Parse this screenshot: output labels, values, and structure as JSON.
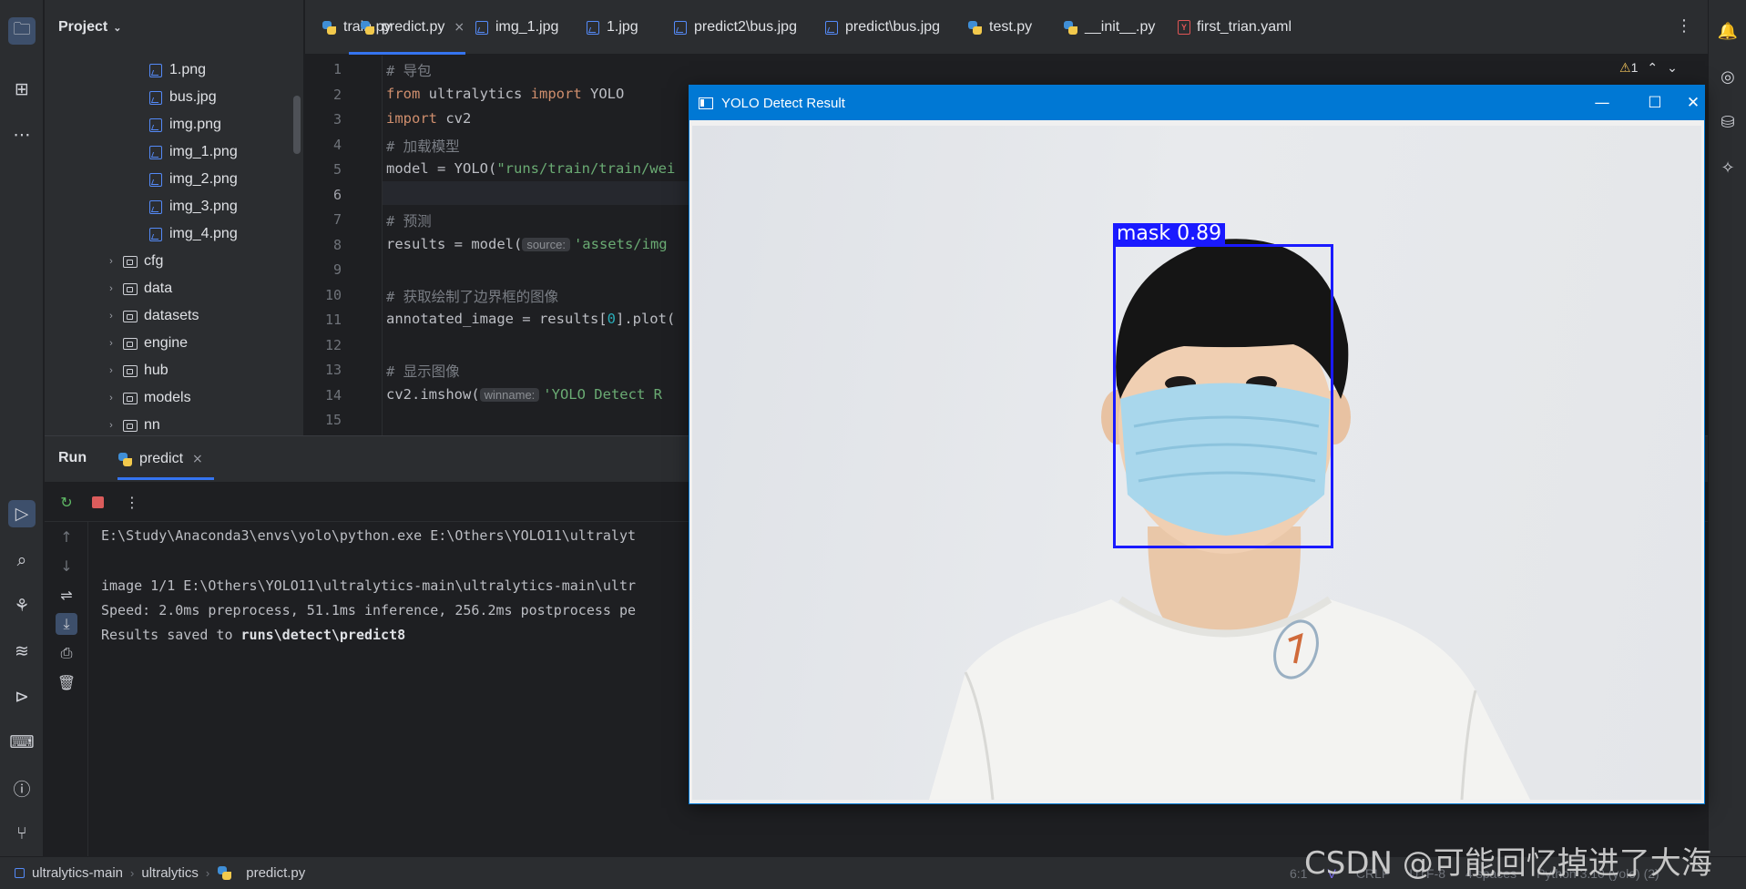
{
  "project_panel": {
    "title": "Project",
    "tree": [
      {
        "name": "1.png",
        "type": "image"
      },
      {
        "name": "bus.jpg",
        "type": "image"
      },
      {
        "name": "img.png",
        "type": "image"
      },
      {
        "name": "img_1.png",
        "type": "image"
      },
      {
        "name": "img_2.png",
        "type": "image"
      },
      {
        "name": "img_3.png",
        "type": "image"
      },
      {
        "name": "img_4.png",
        "type": "image"
      },
      {
        "name": "cfg",
        "type": "folder"
      },
      {
        "name": "data",
        "type": "folder"
      },
      {
        "name": "datasets",
        "type": "folder"
      },
      {
        "name": "engine",
        "type": "folder"
      },
      {
        "name": "hub",
        "type": "folder"
      },
      {
        "name": "models",
        "type": "folder"
      },
      {
        "name": "nn",
        "type": "folder"
      }
    ]
  },
  "tabs": [
    {
      "label": "train.py",
      "icon": "python-icon"
    },
    {
      "label": "predict.py",
      "icon": "python-icon",
      "active": true
    },
    {
      "label": "img_1.jpg",
      "icon": "image-icon"
    },
    {
      "label": "1.jpg",
      "icon": "image-icon"
    },
    {
      "label": "predict2\\bus.jpg",
      "icon": "image-icon"
    },
    {
      "label": "predict\\bus.jpg",
      "icon": "image-icon"
    },
    {
      "label": "test.py",
      "icon": "python-icon"
    },
    {
      "label": "__init__.py",
      "icon": "python-icon"
    },
    {
      "label": "first_trian.yaml",
      "icon": "yaml-icon"
    }
  ],
  "editor": {
    "line_numbers": [
      "1",
      "2",
      "3",
      "4",
      "5",
      "6",
      "7",
      "8",
      "9",
      "10",
      "11",
      "12",
      "13",
      "14",
      "15"
    ],
    "current_line": "6",
    "warnings_count": "1",
    "lines": {
      "l1": "# 导包",
      "l2_kw1": "from",
      "l2_mod": " ultralytics ",
      "l2_kw2": "import",
      "l2_name": " YOLO",
      "l3_kw": "import",
      "l3_name": " cv2",
      "l4": "# 加载模型",
      "l5_code": "model = YOLO(",
      "l5_str": "\"runs/train/train/wei",
      "l7": "# 预测",
      "l8_code": "results = model(",
      "l8_hint": "source:",
      "l8_str": "'assets/img",
      "l10": "# 获取绘制了边界框的图像",
      "l11_code": "annotated_image = results[",
      "l11_num": "0",
      "l11_tail": "].plot(",
      "l13": "# 显示图像",
      "l14_code": "cv2.imshow(",
      "l14_hint": "winname:",
      "l14_str": "'YOLO Detect R"
    }
  },
  "run_panel": {
    "title": "Run",
    "tab_label": "predict",
    "output": {
      "line1": "E:\\Study\\Anaconda3\\envs\\yolo\\python.exe E:\\Others\\YOLO11\\ultralyt",
      "line2": "image 1/1 E:\\Others\\YOLO11\\ultralytics-main\\ultralytics-main\\ultr",
      "line3": "Speed: 2.0ms preprocess, 51.1ms inference, 256.2ms postprocess pe",
      "line4_prefix": "Results saved to ",
      "line4_path": "runs\\detect\\predict8"
    }
  },
  "detect_window": {
    "title": "YOLO Detect Result",
    "detection_label": "mask 0.89"
  },
  "status_bar": {
    "crumbs": [
      "ultralytics-main",
      "ultralytics",
      "predict.py"
    ],
    "position": "6:1",
    "line_sep": "CRLF",
    "encoding": "UTF-8",
    "indent": "4 spaces",
    "interpreter": "Python 3.10 (yolo) (2)"
  },
  "watermark": "CSDN @可能回忆掉进了大海",
  "colors": {
    "accent": "#3574f0",
    "window_title": "#0078d4",
    "bbox": "#1a1aff"
  }
}
